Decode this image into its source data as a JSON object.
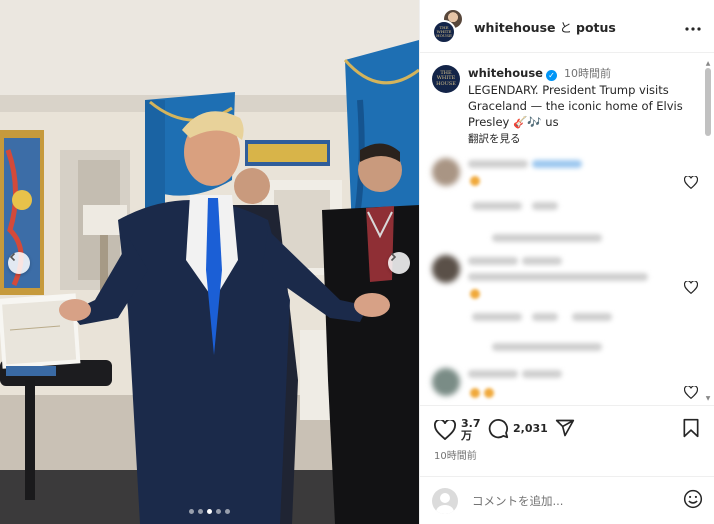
{
  "header": {
    "account_1": "whitehouse",
    "joiner": "と",
    "account_2": "potus",
    "more_icon": "more-horizontal-icon"
  },
  "avatar_text": {
    "line1": "THE",
    "line2": "WHITE",
    "line3": "HOUSE"
  },
  "caption": {
    "username": "whitehouse",
    "verified_icon": "verified-badge-icon",
    "time": "10時間前",
    "text": "LEGENDARY. President Trump visits Graceland — the iconic home of Elvis Presley 🎸🎶 us",
    "translate": "翻訳を見る"
  },
  "actions": {
    "like_count": "3.7万",
    "comment_count": "2,031",
    "like_icon": "heart-icon",
    "comment_icon": "comment-icon",
    "share_icon": "send-icon",
    "save_icon": "bookmark-icon"
  },
  "posted_time": "10時間前",
  "comment_input": {
    "placeholder": "コメントを追加..."
  },
  "carousel": {
    "slides": 5,
    "active_index": 2
  },
  "colors": {
    "brand_navy": "#132448",
    "verified_blue": "#0095f6",
    "drape_blue": "#1e6fb3",
    "suit_navy": "#1b2a4a"
  }
}
